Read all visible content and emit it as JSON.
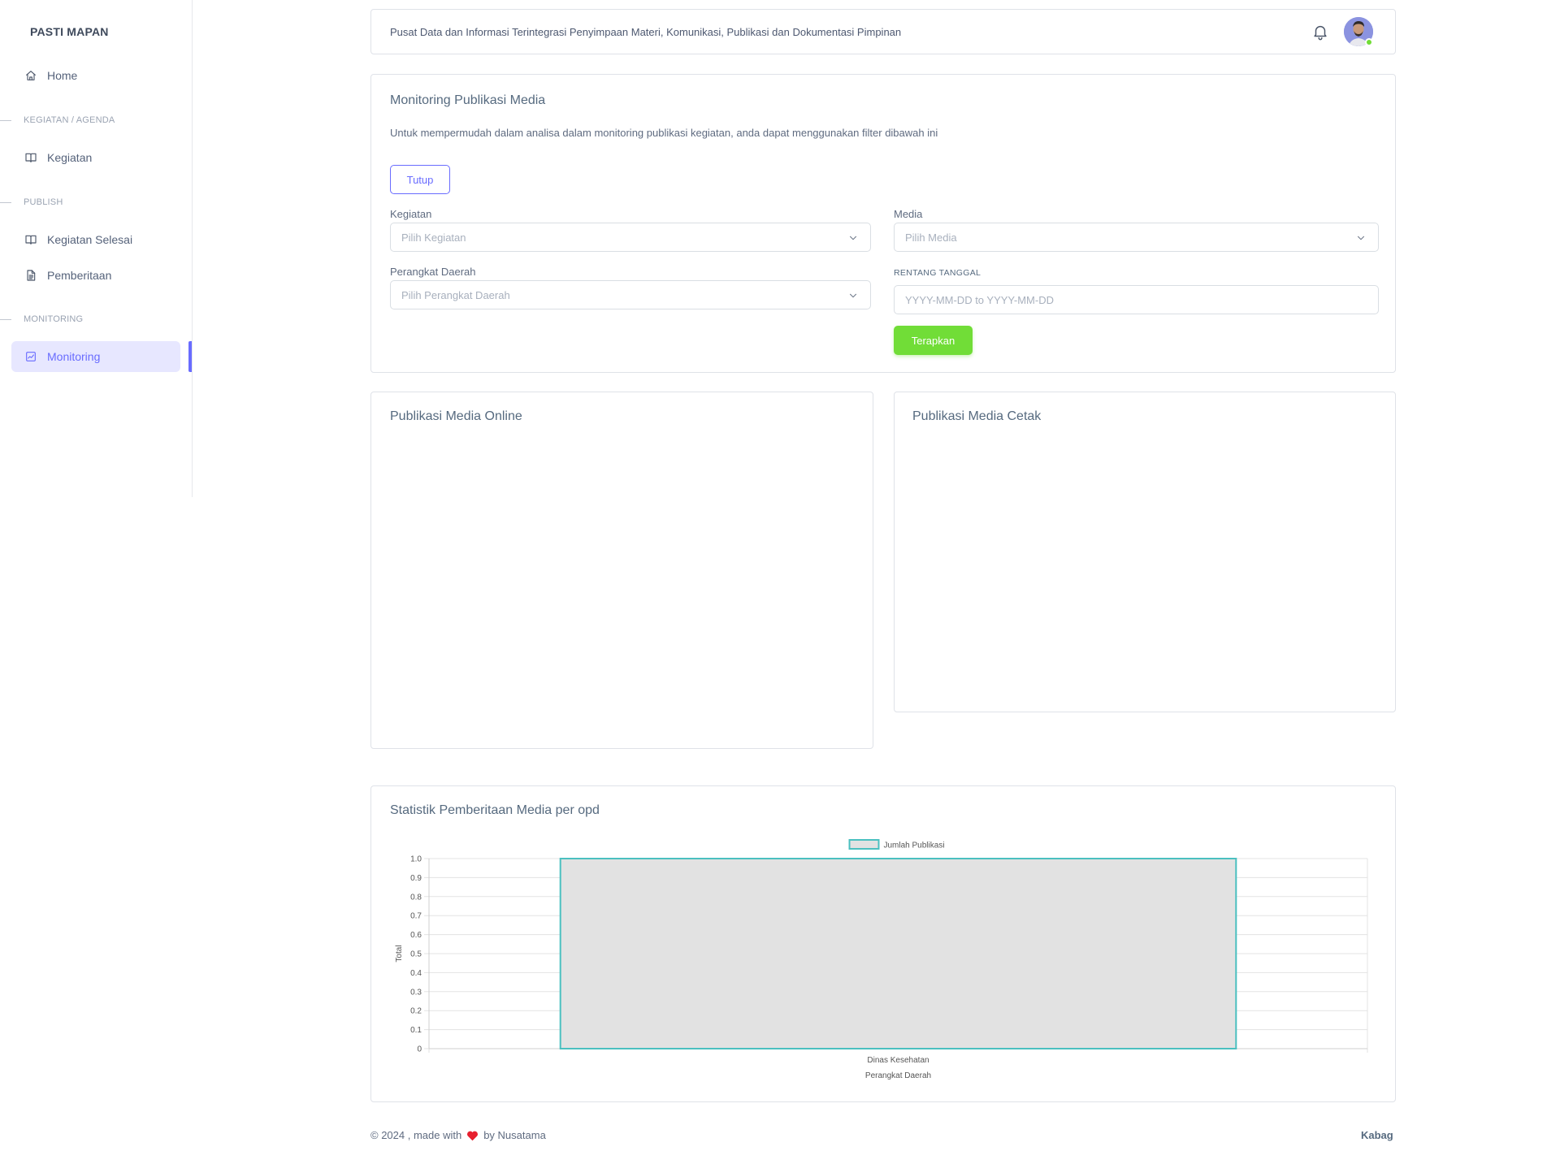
{
  "sidebar": {
    "brand": "PASTI MAPAN",
    "home": "Home",
    "section_kegiatan": "KEGIATAN / AGENDA",
    "kegiatan": "Kegiatan",
    "section_publish": "PUBLISH",
    "kegiatan_selesai": "Kegiatan Selesai",
    "pemberitaan": "Pemberitaan",
    "section_monitoring": "MONITORING",
    "monitoring": "Monitoring"
  },
  "topbar": {
    "title": "Pusat Data dan Informasi Terintegrasi Penyimpaan Materi, Komunikasi, Publikasi dan Dokumentasi Pimpinan"
  },
  "filter": {
    "title": "Monitoring Publikasi Media",
    "description": "Untuk mempermudah dalam analisa dalam monitoring publikasi kegiatan, anda dapat menggunakan filter dibawah ini",
    "close_button": "Tutup",
    "kegiatan_label": "Kegiatan",
    "kegiatan_placeholder": "Pilih Kegiatan",
    "media_label": "Media",
    "media_placeholder": "Pilih Media",
    "perangkat_label": "Perangkat Daerah",
    "perangkat_placeholder": "Pilih Perangkat Daerah",
    "rentang_label": "RENTANG TANGGAL",
    "rentang_placeholder": "YYYY-MM-DD to YYYY-MM-DD",
    "apply_button": "Terapkan"
  },
  "online_card": {
    "title": "Publikasi Media Online"
  },
  "cetak_card": {
    "title": "Publikasi Media Cetak"
  },
  "stat_card": {
    "title": "Statistik Pemberitaan Media per opd"
  },
  "chart_data": {
    "type": "bar",
    "categories": [
      "Dinas Kesehatan"
    ],
    "series": [
      {
        "name": "Jumlah Publikasi",
        "values": [
          1
        ]
      }
    ],
    "xlabel": "Perangkat Daerah",
    "ylabel": "Total",
    "ylim": [
      0,
      1
    ],
    "yticks": [
      "0",
      "0.1",
      "0.2",
      "0.3",
      "0.4",
      "0.5",
      "0.6",
      "0.7",
      "0.8",
      "0.9",
      "1.0"
    ],
    "grid": true,
    "legend": "top-center",
    "colors": {
      "bar_fill": "#e2e2e2",
      "bar_border": "#4bc0c0"
    }
  },
  "footer": {
    "prefix": "© 2024 , made with",
    "suffix": "by Nusatama",
    "right": "Kabag"
  },
  "colors": {
    "primary": "#696cff",
    "success": "#71dd37",
    "heart": "#e7202f"
  }
}
